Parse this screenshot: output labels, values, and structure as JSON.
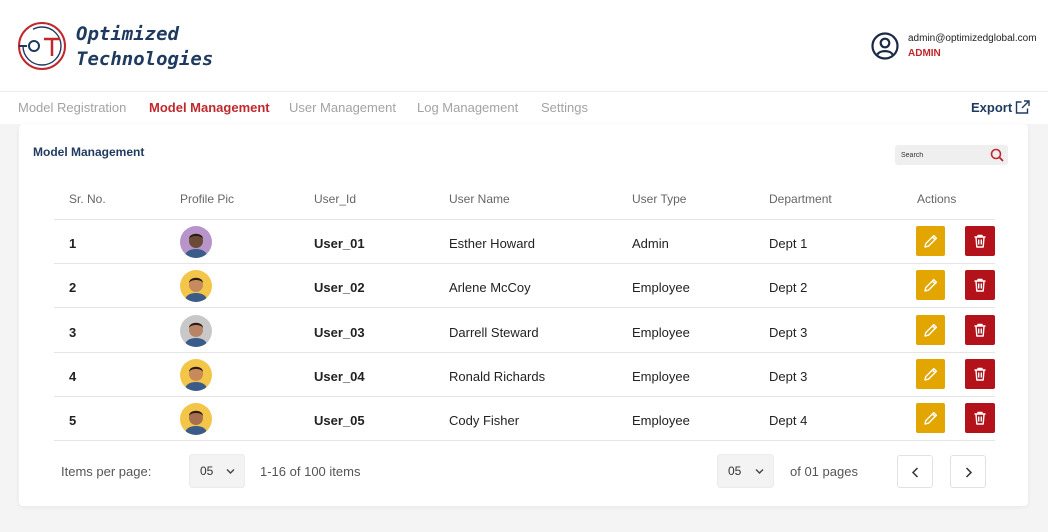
{
  "brand": {
    "line1": "Optimized",
    "line2": "Technologies",
    "logo_icon": "ot-logo-icon",
    "color": "#1f3a5f",
    "accent": "#c0282d"
  },
  "user": {
    "email": "admin@optimizedglobal.com",
    "role": "ADMIN",
    "icon": "user-circle-icon"
  },
  "nav": {
    "tabs": [
      {
        "label": "Model Registration",
        "active": false
      },
      {
        "label": "Model Management",
        "active": true
      },
      {
        "label": "User Management",
        "active": false
      },
      {
        "label": "Log Management",
        "active": false
      },
      {
        "label": "Settings",
        "active": false
      }
    ],
    "export_label": "Export",
    "export_icon": "external-link-icon"
  },
  "card": {
    "title": "Model Management",
    "search_placeholder": "Search",
    "search_icon": "search-icon"
  },
  "table": {
    "headers": [
      "Sr. No.",
      "Profile Pic",
      "User_Id",
      "User Name",
      "User Type",
      "Department",
      "Actions"
    ],
    "rows": [
      {
        "sr": "1",
        "user_id": "User_01",
        "name": "Esther Howard",
        "type": "Admin",
        "dept": "Dept 1",
        "avatar_bg": "#b794c9",
        "skin": "#6b4a36"
      },
      {
        "sr": "2",
        "user_id": "User_02",
        "name": "Arlene McCoy",
        "type": "Employee",
        "dept": "Dept 2",
        "avatar_bg": "#f3c64a",
        "skin": "#c58a5e"
      },
      {
        "sr": "3",
        "user_id": "User_03",
        "name": "Darrell Steward",
        "type": "Employee",
        "dept": "Dept 3",
        "avatar_bg": "#c8c8c8",
        "skin": "#b98466"
      },
      {
        "sr": "4",
        "user_id": "User_04",
        "name": "Ronald Richards",
        "type": "Employee",
        "dept": "Dept 3",
        "avatar_bg": "#f3c64a",
        "skin": "#c98a5a"
      },
      {
        "sr": "5",
        "user_id": "User_05",
        "name": "Cody Fisher",
        "type": "Employee",
        "dept": "Dept 4",
        "avatar_bg": "#f3c64a",
        "skin": "#a8704e"
      }
    ],
    "edit_icon": "pencil-icon",
    "delete_icon": "trash-icon",
    "edit_color": "#e3a500",
    "delete_color": "#b3121a"
  },
  "pagination": {
    "items_per_page_label": "Items per page:",
    "items_per_page_value": "05",
    "range_text": "1-16 of 100 items",
    "page_value": "05",
    "pages_text": "of 01 pages",
    "prev_icon": "chevron-left-icon",
    "next_icon": "chevron-right-icon"
  }
}
